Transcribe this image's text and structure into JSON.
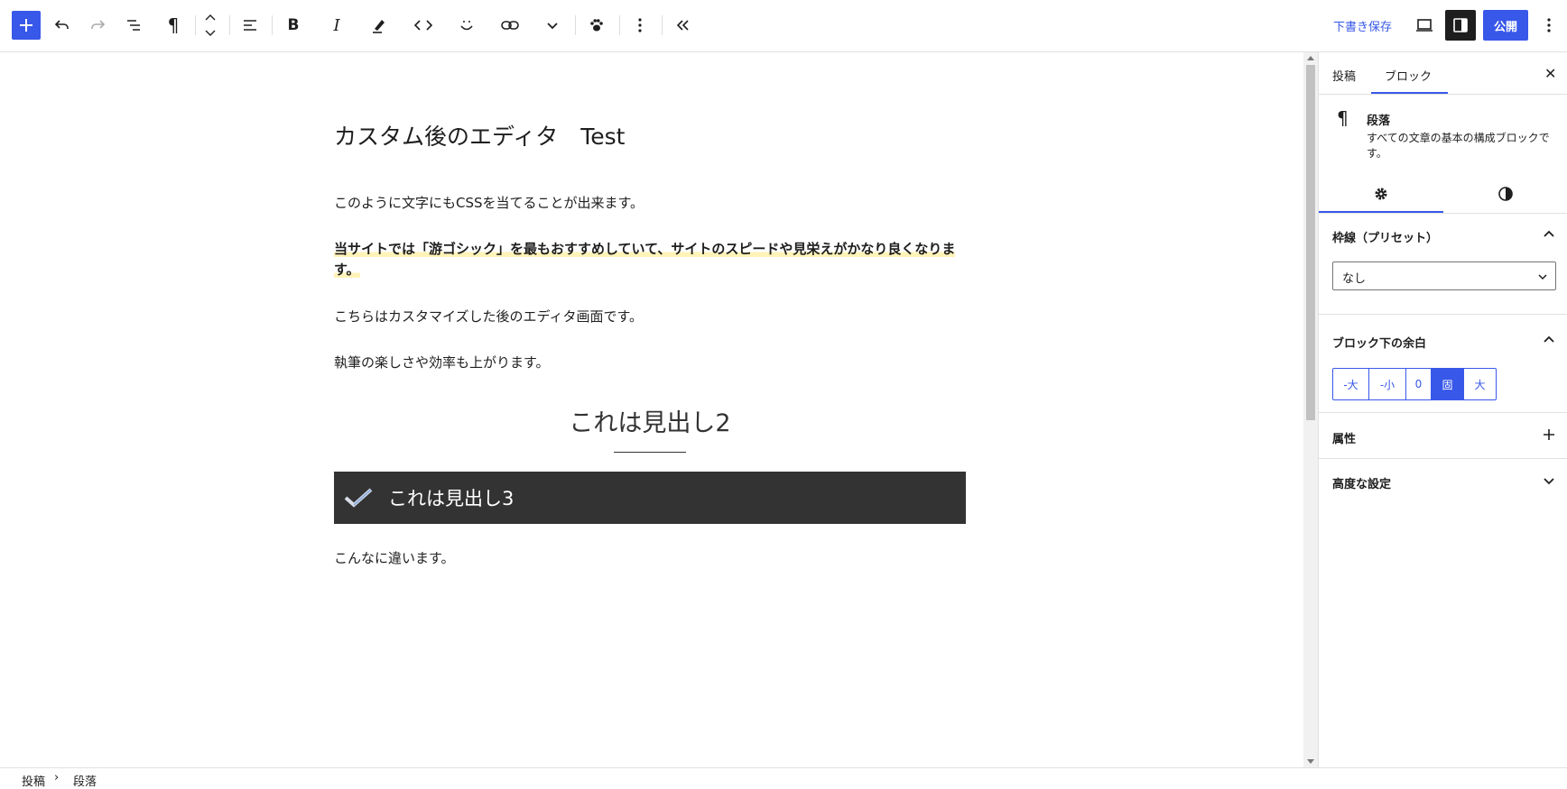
{
  "toolbar": {
    "icons": [
      "plus-icon",
      "undo-icon",
      "redo-icon",
      "list-view-icon",
      "pilcrow-icon",
      "move-updown-icon",
      "align-left-icon",
      "bold-icon",
      "italic-icon",
      "highlight-icon",
      "code-icon",
      "emoji-icon",
      "link-icon",
      "chevron-down-icon",
      "paw-icon",
      "more-vertical-icon",
      "collapse-icon",
      "preview-icon",
      "settings-icon",
      "options-icon"
    ],
    "save_draft": "下書き保存",
    "publish": "公開",
    "bold_glyph": "B",
    "italic_glyph": "I",
    "pilcrow_glyph": "¶"
  },
  "editor": {
    "title": "カスタム後のエディタ　Test",
    "paragraph1": "このように文字にもCSSを当てることが出来ます。",
    "paragraph2": "当サイトでは「游ゴシック」を最もおすすめしていて、サイトのスピードや見栄えがかなり良くなります。",
    "paragraph3": "こちらはカスタマイズした後のエディタ画面です。",
    "paragraph4": "執筆の楽しさや効率も上がります。",
    "heading2": "これは見出し2",
    "heading3": "これは見出し3",
    "paragraph5": "こんなに違います。"
  },
  "sidebar": {
    "tabs": [
      {
        "label": "投稿"
      },
      {
        "label": "ブロック"
      }
    ],
    "close_glyph": "✕",
    "block": {
      "icon_glyph": "¶",
      "title": "段落",
      "description": "すべての文章の基本の構成ブロックです。"
    },
    "panels": {
      "border": {
        "title": "枠線（プリセット）",
        "select_value": "なし"
      },
      "margin": {
        "title": "ブロック下の余白",
        "options": [
          "-大",
          "-小",
          "0",
          "固",
          "大"
        ],
        "selected": "固"
      },
      "attributes": {
        "title": "属性"
      },
      "advanced": {
        "title": "高度な設定"
      }
    }
  },
  "breadcrumb": {
    "items": [
      "投稿",
      "段落"
    ],
    "separator": "›"
  },
  "colors": {
    "accent": "#3858e9",
    "heading3_bg": "#333333",
    "highlight": "#fff3b8"
  }
}
